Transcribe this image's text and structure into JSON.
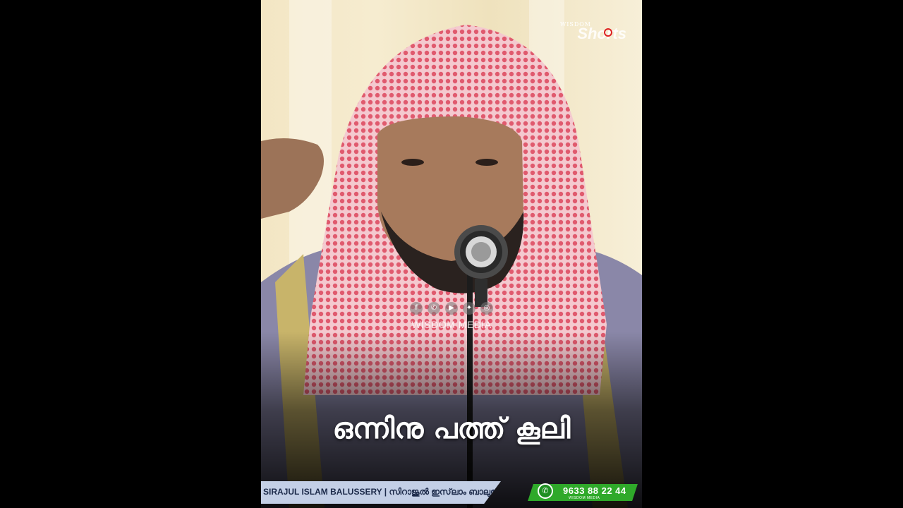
{
  "logo": {
    "small": "WISDOM",
    "big": "Shorts"
  },
  "watermark": {
    "icons": [
      "facebook-icon",
      "whatsapp-icon",
      "youtube-icon",
      "twitter-icon",
      "instagram-icon"
    ],
    "glyphs": [
      "f",
      "✆",
      "▶",
      "✦",
      "◎"
    ],
    "text": "WISDOM MEDIA"
  },
  "caption": "ഒന്നിനു പത്ത് കൂലി",
  "lower_third": {
    "name": "SIRAJUL ISLAM BALUSSERY | സിറാജുൽ ഇസ്‌ലാം ബാലുശ്ശേരി",
    "phone": "9633 88 22 44",
    "phone_sub": "WISDOM MEDIA"
  },
  "colors": {
    "headscarf": "#e06a7a",
    "phone_bar": "#2fa92a",
    "name_bar": "#c3cfe6"
  }
}
